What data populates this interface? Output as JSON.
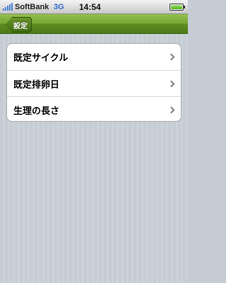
{
  "status_bar": {
    "carrier": "SoftBank",
    "network": "3G",
    "time": "14:54"
  },
  "nav_bar": {
    "back_label": "設定",
    "accent_color": "#6f9c2c"
  },
  "settings_list": {
    "items": [
      {
        "label": "既定サイクル",
        "icon": "chevron-right-icon"
      },
      {
        "label": "既定排卵日",
        "icon": "chevron-right-icon"
      },
      {
        "label": "生理の長さ",
        "icon": "chevron-right-icon"
      }
    ]
  }
}
